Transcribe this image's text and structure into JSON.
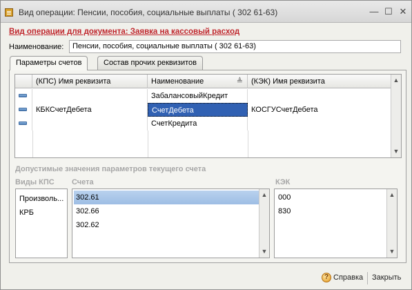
{
  "window": {
    "title": "Вид операции: Пенсии, пособия, социальные выплаты ( 302 61-63)",
    "minimize": "—",
    "maximize": "☐",
    "close": "✕"
  },
  "heading": "Вид операции для документа: Заявка на кассовый расход",
  "name_field": {
    "label": "Наименование:",
    "value": "Пенсии, пособия, социальные выплаты ( 302 61-63)"
  },
  "tabs": [
    {
      "label": "Параметры счетов"
    },
    {
      "label": "Состав прочих реквизитов"
    }
  ],
  "grid": {
    "columns": [
      "(КПС) Имя реквизита",
      "Наименование",
      "(КЭК) Имя реквизита"
    ],
    "sort_indicator": "≜",
    "rows": [
      {
        "kps": "",
        "name": "ЗабалансовыйКредит",
        "kek": ""
      },
      {
        "kps": "КБКСчетДебета",
        "name": "СчетДебета",
        "kek": "КОСГУСчетДебета"
      },
      {
        "kps": "",
        "name": "СчетКредита",
        "kek": ""
      }
    ]
  },
  "allowed": {
    "title": "Допустимые значения параметров текущего счета",
    "kps_label": "Виды КПС",
    "kps_items": [
      "Произволь...",
      "КРБ"
    ],
    "accounts_label": "Счета",
    "accounts": [
      "302.61",
      "302.66",
      "302.62"
    ],
    "kek_label": "КЭК",
    "kek_items": [
      "000",
      "830"
    ]
  },
  "footer": {
    "help_label": "Справка",
    "help_icon": "?",
    "close_label": "Закрыть"
  },
  "scroll": {
    "up": "▲",
    "down": "▼"
  }
}
